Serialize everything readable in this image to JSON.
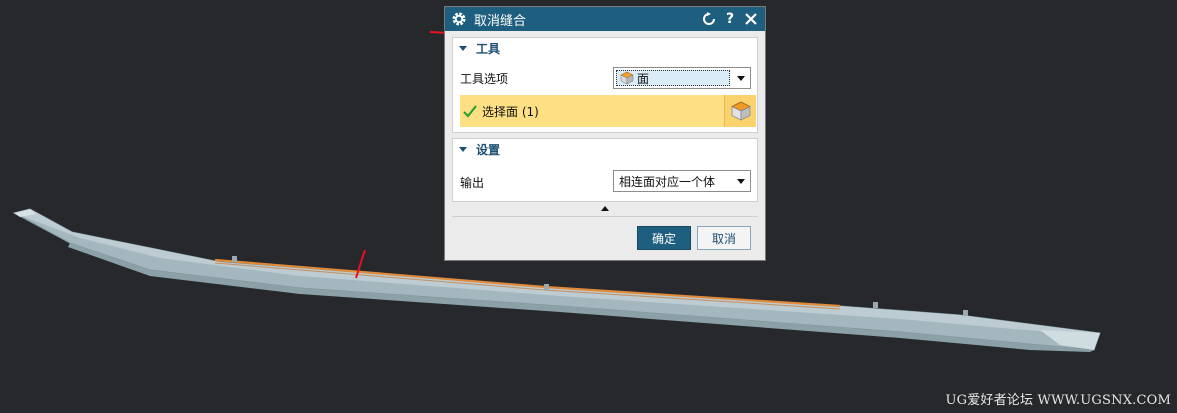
{
  "dialog": {
    "title": "取消缝合",
    "section_tool": {
      "header": "工具",
      "tool_option_label": "工具选项",
      "tool_option_value": "面",
      "select_face_label": "选择面 (1)"
    },
    "section_settings": {
      "header": "设置",
      "output_label": "输出",
      "output_value": "相连面对应一个体"
    },
    "ok_label": "确定",
    "cancel_label": "取消"
  },
  "watermark": "UG爱好者论坛 WWW.UGSNX.COM",
  "colors": {
    "titlebar": "#1e5e7e",
    "viewport_bg": "#26282b",
    "highlight_row": "#fddf84",
    "part_body": "#a9bcc3",
    "selected_edge": "#e08a3a",
    "annotation_red": "#e8101e"
  },
  "icons": [
    "gear-icon",
    "reset-icon",
    "help-icon",
    "close-icon",
    "face-icon",
    "check-icon",
    "face-select-icon"
  ]
}
